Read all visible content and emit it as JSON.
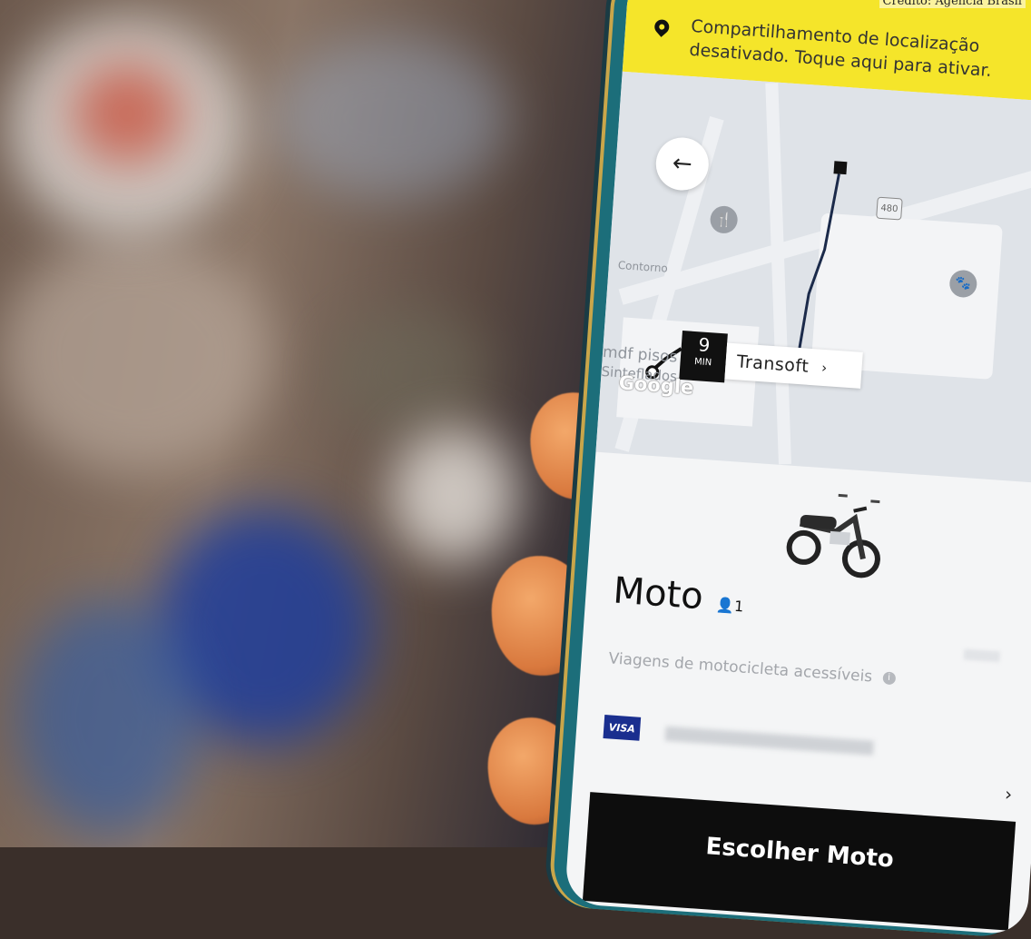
{
  "watermark": "Crédito: Agência Brasil",
  "banner": {
    "text": "Compartilhamento de localização desativado. Toque aqui para ativar.",
    "color": "#f5e52a",
    "icon": "location-pin-icon"
  },
  "map": {
    "back_icon": "←",
    "labels": [
      "Contorno",
      "mdf pisos",
      "Sinteflados"
    ],
    "route_number": "480",
    "eta_value": "9",
    "eta_unit": "MIN",
    "destination": "Transoft",
    "destination_chevron": "›",
    "attribution": "Google"
  },
  "product": {
    "name": "Moto",
    "seats": "1",
    "description": "Viagens de motocicleta acessíveis"
  },
  "payment": {
    "brand": "VISA",
    "chevron": "›"
  },
  "cta": {
    "label": "Escolher Moto"
  }
}
